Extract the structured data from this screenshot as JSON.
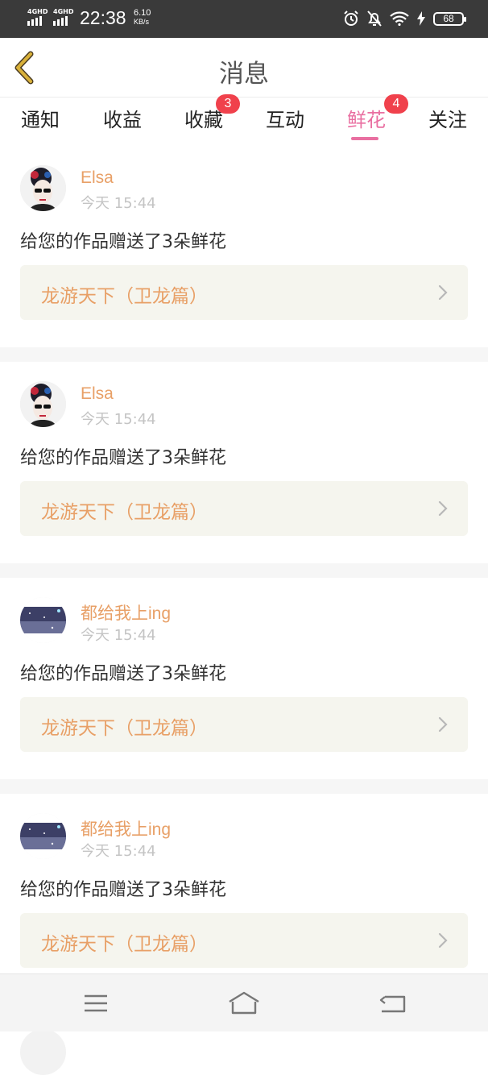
{
  "status_bar": {
    "network1": "4GHD",
    "network2": "4GHD",
    "time": "22:38",
    "speed_value": "6.10",
    "speed_unit": "KB/s",
    "battery": "68"
  },
  "header": {
    "title": "消息"
  },
  "tabs": [
    {
      "label": "通知",
      "badge": ""
    },
    {
      "label": "收益",
      "badge": ""
    },
    {
      "label": "收藏",
      "badge": "3"
    },
    {
      "label": "互动",
      "badge": ""
    },
    {
      "label": "鲜花",
      "badge": "4",
      "active": true
    },
    {
      "label": "关注",
      "badge": ""
    }
  ],
  "messages": [
    {
      "username": "Elsa",
      "time": "今天 15:44",
      "text": "给您的作品赠送了3朵鲜花",
      "work": "龙游天下（卫龙篇）",
      "avatar": "woman-portrait-icon"
    },
    {
      "username": "Elsa",
      "time": "今天 15:44",
      "text": "给您的作品赠送了3朵鲜花",
      "work": "龙游天下（卫龙篇）",
      "avatar": "woman-portrait-icon"
    },
    {
      "username": "都给我上ing",
      "time": "今天 15:44",
      "text": "给您的作品赠送了3朵鲜花",
      "work": "龙游天下（卫龙篇）",
      "avatar": "night-sky-icon"
    },
    {
      "username": "都给我上ing",
      "time": "今天 15:44",
      "text": "给您的作品赠送了3朵鲜花",
      "work": "龙游天下（卫龙篇）",
      "avatar": "night-sky-icon"
    }
  ],
  "colors": {
    "accent_pink": "#e96fa1",
    "accent_orange": "#e8a067",
    "badge_red": "#f0414c",
    "back_arrow": "#d9b13a"
  }
}
